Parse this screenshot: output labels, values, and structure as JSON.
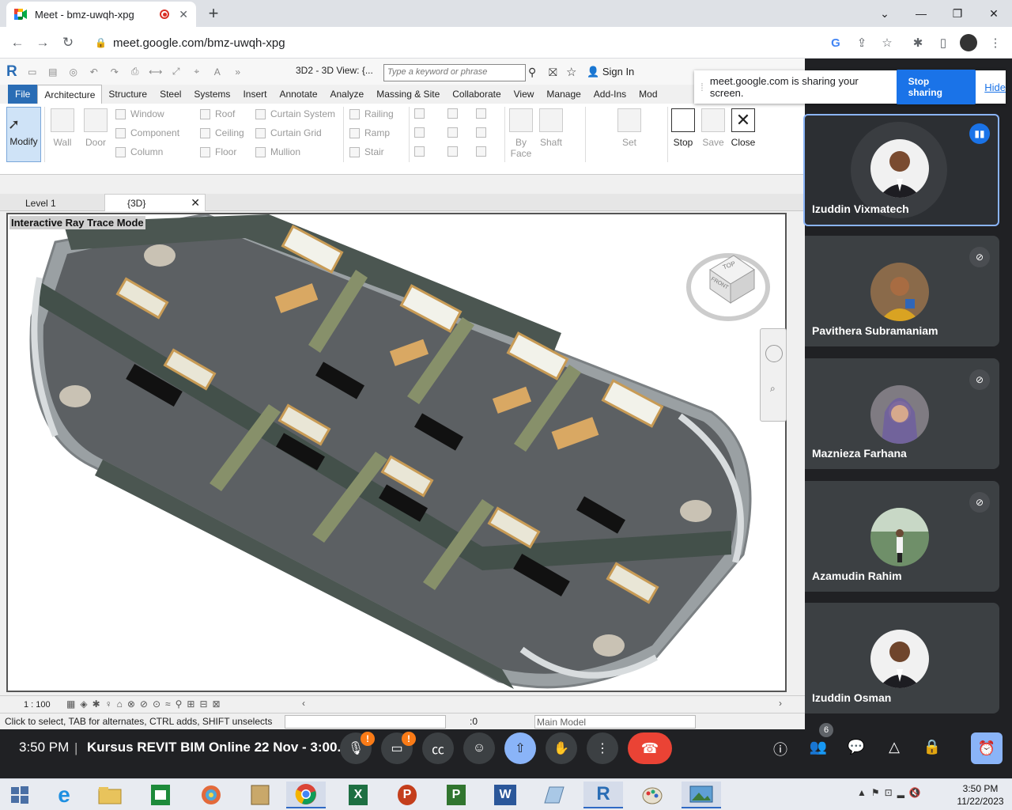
{
  "browser": {
    "tab_title": "Meet - bmz-uwqh-xpg",
    "url": "meet.google.com/bmz-uwqh-xpg",
    "new_tab": "+",
    "minimize": "⌄",
    "close_tab": "✕"
  },
  "revit": {
    "view_title": "3D2 - 3D View: {...",
    "search_placeholder": "Type a keyword or phrase",
    "sign_in": "Sign In",
    "menu": [
      "File",
      "Architecture",
      "Structure",
      "Steel",
      "Systems",
      "Insert",
      "Annotate",
      "Analyze",
      "Massing & Site",
      "Collaborate",
      "View",
      "Manage",
      "Add-Ins",
      "Mod"
    ],
    "active_menu": "Architecture",
    "ribbon": {
      "modify": "Modify",
      "wall": "Wall",
      "door": "Door",
      "window": "Window",
      "component": "Component",
      "column": "Column",
      "roof": "Roof",
      "ceiling": "Ceiling",
      "floor": "Floor",
      "curtain_system": "Curtain System",
      "curtain_grid": "Curtain Grid",
      "mullion": "Mullion",
      "railing": "Railing",
      "ramp": "Ramp",
      "stair": "Stair",
      "by_face": "By Face",
      "shaft": "Shaft",
      "set": "Set",
      "stop": "Stop",
      "save": "Save",
      "close": "Close"
    },
    "view_tabs": [
      "Level 1",
      "{3D}"
    ],
    "viewport_label": "Interactive Ray Trace Mode",
    "viewcube_top": "TOP",
    "viewcube_front": "FRONT",
    "scale": "1 : 100",
    "status": "Click to select, TAB for alternates, CTRL adds, SHIFT unselects",
    "selection_count": ":0",
    "model": "Main Model"
  },
  "share_banner": {
    "text": "meet.google.com is sharing your screen.",
    "stop": "Stop sharing",
    "hide": "Hide"
  },
  "participants": [
    {
      "name": "Izuddin Vixmatech",
      "speaking": true
    },
    {
      "name": "Pavithera Subramaniam",
      "muted": true
    },
    {
      "name": "Maznieza Farhana",
      "muted": true
    },
    {
      "name": "Azamudin Rahim",
      "muted": true
    },
    {
      "name": "Izuddin Osman",
      "muted": false
    }
  ],
  "meet_bar": {
    "time": "3:50 PM",
    "divider": "|",
    "title": "Kursus REVIT BIM Online 22 Nov - 3:00...",
    "alert_mark": "!",
    "participant_count": "6"
  },
  "taskbar": {
    "clock_time": "3:50 PM",
    "clock_date": "11/22/2023",
    "apps": [
      "start",
      "ie",
      "explorer",
      "excel-green",
      "chrome",
      "excel",
      "powerpoint",
      "project",
      "word",
      "file",
      "revit",
      "paint",
      "photos"
    ]
  },
  "colors": {
    "revit_blue": "#2a6db5",
    "meet_blue": "#1a73e8",
    "end_call_red": "#ea4335",
    "meet_dark": "#202124"
  }
}
